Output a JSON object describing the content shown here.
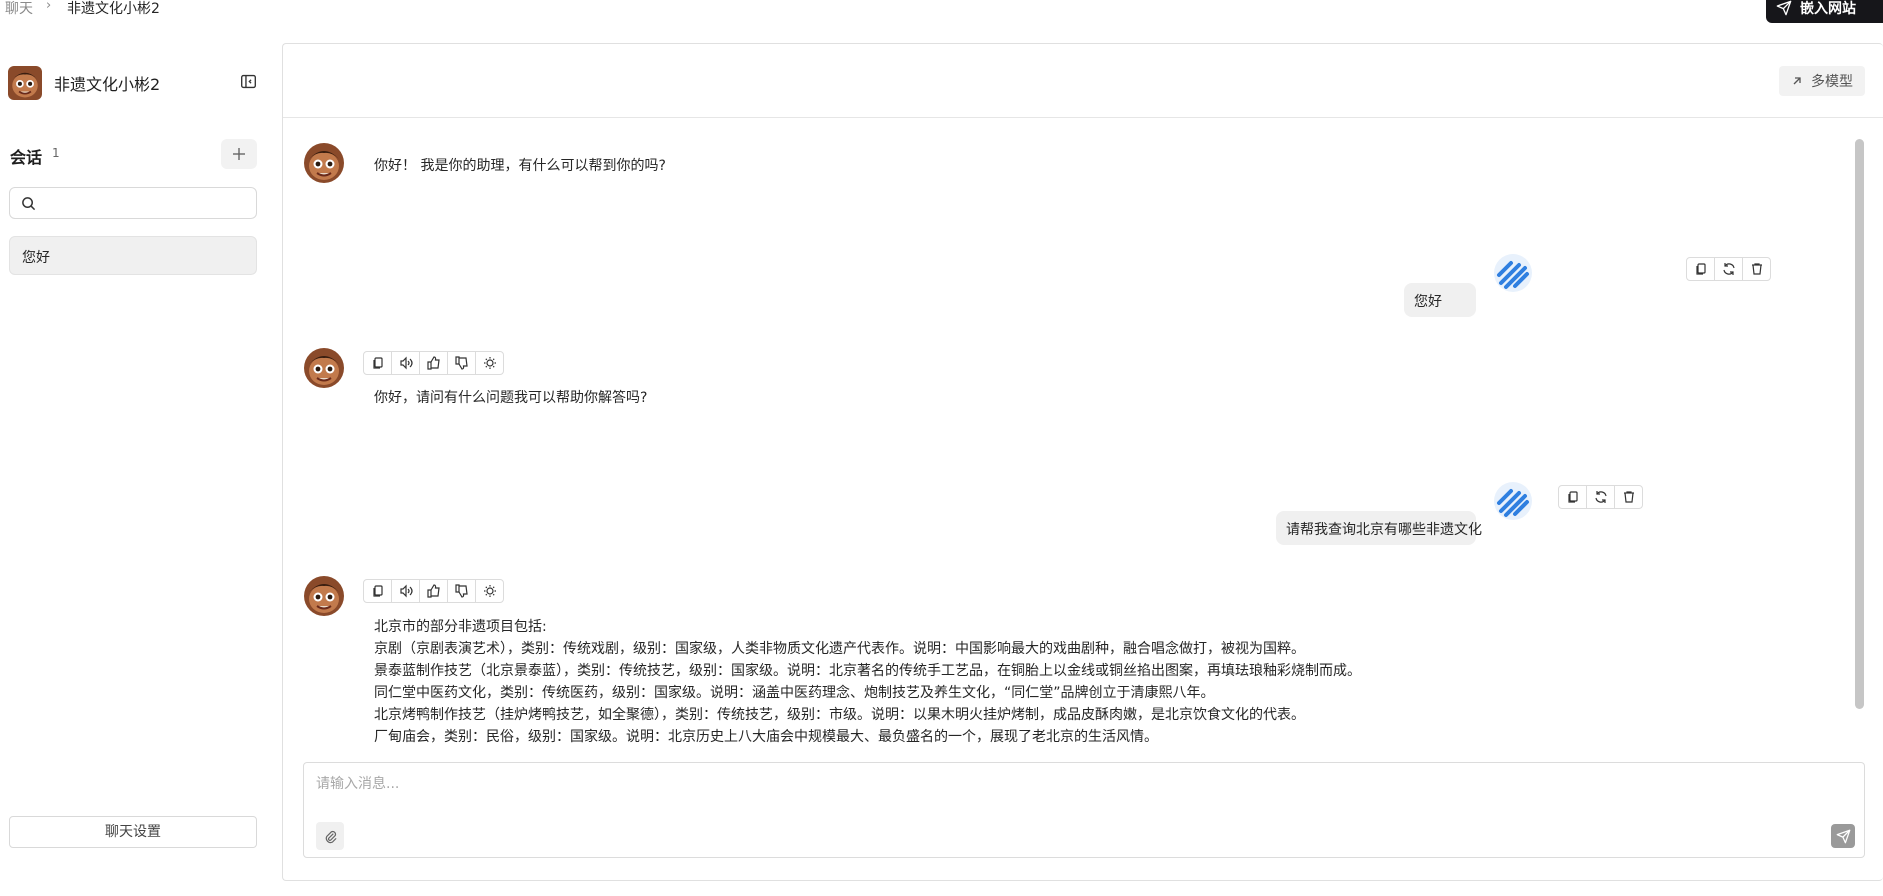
{
  "breadcrumb": {
    "root": "聊天",
    "separator": "›",
    "current": "非遗文化小彬2"
  },
  "header": {
    "embed_label": "嵌入网站",
    "multi_model_label": "多模型"
  },
  "sidebar": {
    "bot_name": "非遗文化小彬2",
    "sessions_title": "会话",
    "sessions_count": "1",
    "search_placeholder": "",
    "sessions": [
      {
        "label": "您好"
      }
    ],
    "settings_label": "聊天设置"
  },
  "messages": [
    {
      "role": "assistant",
      "text": "你好！ 我是你的助理，有什么可以帮到你的吗?"
    },
    {
      "role": "user",
      "text": "您好"
    },
    {
      "role": "assistant",
      "text": "你好，请问有什么问题我可以帮助你解答吗?"
    },
    {
      "role": "user",
      "text": "请帮我查询北京有哪些非遗文化"
    },
    {
      "role": "assistant",
      "lines": [
        "北京市的部分非遗项目包括:",
        "京剧（京剧表演艺术），类别：传统戏剧，级别：国家级，人类非物质文化遗产代表作。说明：中国影响最大的戏曲剧种，融合唱念做打，被视为国粹。",
        "景泰蓝制作技艺（北京景泰蓝），类别：传统技艺，级别：国家级。说明：北京著名的传统手工艺品，在铜胎上以金线或铜丝掐出图案，再填珐琅釉彩烧制而成。",
        "同仁堂中医药文化，类别：传统医药，级别：国家级。说明：涵盖中医药理念、炮制技艺及养生文化，“同仁堂”品牌创立于清康熙八年。",
        "北京烤鸭制作技艺（挂炉烤鸭技艺，如全聚德），类别：传统技艺，级别：市级。说明：以果木明火挂炉烤制，成品皮酥肉嫩，是北京饮食文化的代表。",
        "厂甸庙会，类别：民俗，级别：国家级。说明：北京历史上八大庙会中规模最大、最负盛名的一个，展现了老北京的生活风情。"
      ]
    }
  ],
  "composer": {
    "placeholder": "请输入消息..."
  },
  "colors": {
    "accent_user": "#2f7fe0",
    "dark_button": "#16161a"
  }
}
